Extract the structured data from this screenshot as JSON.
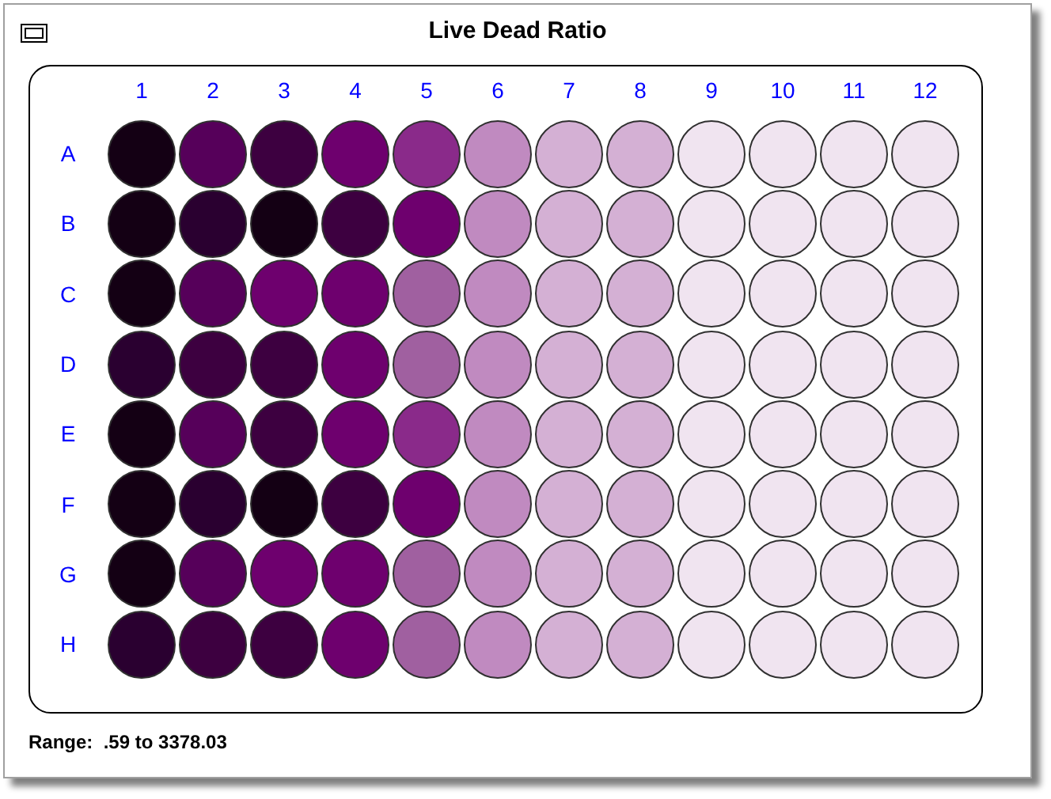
{
  "window": {
    "title": "Live Dead Ratio"
  },
  "plate": {
    "columns": [
      "1",
      "2",
      "3",
      "4",
      "5",
      "6",
      "7",
      "8",
      "9",
      "10",
      "11",
      "12"
    ],
    "rows": [
      {
        "label": "A",
        "wells": [
          {
            "color": "#140014"
          },
          {
            "color": "#56005a"
          },
          {
            "color": "#3d0040"
          },
          {
            "color": "#6e006e"
          },
          {
            "color": "#8a2a8a"
          },
          {
            "color": "#c08ac0"
          },
          {
            "color": "#d4b0d4"
          },
          {
            "color": "#d4b0d4"
          },
          {
            "color": "#f0e4f0"
          },
          {
            "color": "#f0e4f0"
          },
          {
            "color": "#f0e4f0"
          },
          {
            "color": "#f0e4f0"
          }
        ]
      },
      {
        "label": "B",
        "wells": [
          {
            "color": "#140014"
          },
          {
            "color": "#2a0030"
          },
          {
            "color": "#140014"
          },
          {
            "color": "#3d0040"
          },
          {
            "color": "#6e006e"
          },
          {
            "color": "#c08ac0"
          },
          {
            "color": "#d4b0d4"
          },
          {
            "color": "#d4b0d4"
          },
          {
            "color": "#f0e4f0"
          },
          {
            "color": "#f0e4f0"
          },
          {
            "color": "#f0e4f0"
          },
          {
            "color": "#f0e4f0"
          }
        ]
      },
      {
        "label": "C",
        "wells": [
          {
            "color": "#140014"
          },
          {
            "color": "#56005a"
          },
          {
            "color": "#6e006e"
          },
          {
            "color": "#6e006e"
          },
          {
            "color": "#a060a0"
          },
          {
            "color": "#c08ac0"
          },
          {
            "color": "#d4b0d4"
          },
          {
            "color": "#d4b0d4"
          },
          {
            "color": "#f0e4f0"
          },
          {
            "color": "#f0e4f0"
          },
          {
            "color": "#f0e4f0"
          },
          {
            "color": "#f0e4f0"
          }
        ]
      },
      {
        "label": "D",
        "wells": [
          {
            "color": "#2a0030"
          },
          {
            "color": "#3d0040"
          },
          {
            "color": "#3d0040"
          },
          {
            "color": "#6e006e"
          },
          {
            "color": "#a060a0"
          },
          {
            "color": "#c08ac0"
          },
          {
            "color": "#d4b0d4"
          },
          {
            "color": "#d4b0d4"
          },
          {
            "color": "#f0e4f0"
          },
          {
            "color": "#f0e4f0"
          },
          {
            "color": "#f0e4f0"
          },
          {
            "color": "#f0e4f0"
          }
        ]
      },
      {
        "label": "E",
        "wells": [
          {
            "color": "#140014"
          },
          {
            "color": "#56005a"
          },
          {
            "color": "#3d0040"
          },
          {
            "color": "#6e006e"
          },
          {
            "color": "#8a2a8a"
          },
          {
            "color": "#c08ac0"
          },
          {
            "color": "#d4b0d4"
          },
          {
            "color": "#d4b0d4"
          },
          {
            "color": "#f0e4f0"
          },
          {
            "color": "#f0e4f0"
          },
          {
            "color": "#f0e4f0"
          },
          {
            "color": "#f0e4f0"
          }
        ]
      },
      {
        "label": "F",
        "wells": [
          {
            "color": "#140014"
          },
          {
            "color": "#2a0030"
          },
          {
            "color": "#140014"
          },
          {
            "color": "#3d0040"
          },
          {
            "color": "#6e006e"
          },
          {
            "color": "#c08ac0"
          },
          {
            "color": "#d4b0d4"
          },
          {
            "color": "#d4b0d4"
          },
          {
            "color": "#f0e4f0"
          },
          {
            "color": "#f0e4f0"
          },
          {
            "color": "#f0e4f0"
          },
          {
            "color": "#f0e4f0"
          }
        ]
      },
      {
        "label": "G",
        "wells": [
          {
            "color": "#140014"
          },
          {
            "color": "#56005a"
          },
          {
            "color": "#6e006e"
          },
          {
            "color": "#6e006e"
          },
          {
            "color": "#a060a0"
          },
          {
            "color": "#c08ac0"
          },
          {
            "color": "#d4b0d4"
          },
          {
            "color": "#d4b0d4"
          },
          {
            "color": "#f0e4f0"
          },
          {
            "color": "#f0e4f0"
          },
          {
            "color": "#f0e4f0"
          },
          {
            "color": "#f0e4f0"
          }
        ]
      },
      {
        "label": "H",
        "wells": [
          {
            "color": "#2a0030"
          },
          {
            "color": "#3d0040"
          },
          {
            "color": "#3d0040"
          },
          {
            "color": "#6e006e"
          },
          {
            "color": "#a060a0"
          },
          {
            "color": "#c08ac0"
          },
          {
            "color": "#d4b0d4"
          },
          {
            "color": "#d4b0d4"
          },
          {
            "color": "#f0e4f0"
          },
          {
            "color": "#f0e4f0"
          },
          {
            "color": "#f0e4f0"
          },
          {
            "color": "#f0e4f0"
          }
        ]
      }
    ]
  },
  "range": "Range:  .59 to 3378.03"
}
